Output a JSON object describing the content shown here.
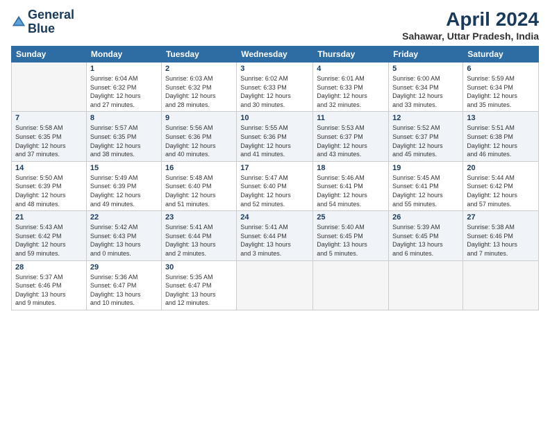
{
  "logo": {
    "line1": "General",
    "line2": "Blue"
  },
  "title": "April 2024",
  "subtitle": "Sahawar, Uttar Pradesh, India",
  "weekdays": [
    "Sunday",
    "Monday",
    "Tuesday",
    "Wednesday",
    "Thursday",
    "Friday",
    "Saturday"
  ],
  "weeks": [
    [
      {
        "day": "",
        "info": ""
      },
      {
        "day": "1",
        "info": "Sunrise: 6:04 AM\nSunset: 6:32 PM\nDaylight: 12 hours\nand 27 minutes."
      },
      {
        "day": "2",
        "info": "Sunrise: 6:03 AM\nSunset: 6:32 PM\nDaylight: 12 hours\nand 28 minutes."
      },
      {
        "day": "3",
        "info": "Sunrise: 6:02 AM\nSunset: 6:33 PM\nDaylight: 12 hours\nand 30 minutes."
      },
      {
        "day": "4",
        "info": "Sunrise: 6:01 AM\nSunset: 6:33 PM\nDaylight: 12 hours\nand 32 minutes."
      },
      {
        "day": "5",
        "info": "Sunrise: 6:00 AM\nSunset: 6:34 PM\nDaylight: 12 hours\nand 33 minutes."
      },
      {
        "day": "6",
        "info": "Sunrise: 5:59 AM\nSunset: 6:34 PM\nDaylight: 12 hours\nand 35 minutes."
      }
    ],
    [
      {
        "day": "7",
        "info": "Sunrise: 5:58 AM\nSunset: 6:35 PM\nDaylight: 12 hours\nand 37 minutes."
      },
      {
        "day": "8",
        "info": "Sunrise: 5:57 AM\nSunset: 6:35 PM\nDaylight: 12 hours\nand 38 minutes."
      },
      {
        "day": "9",
        "info": "Sunrise: 5:56 AM\nSunset: 6:36 PM\nDaylight: 12 hours\nand 40 minutes."
      },
      {
        "day": "10",
        "info": "Sunrise: 5:55 AM\nSunset: 6:36 PM\nDaylight: 12 hours\nand 41 minutes."
      },
      {
        "day": "11",
        "info": "Sunrise: 5:53 AM\nSunset: 6:37 PM\nDaylight: 12 hours\nand 43 minutes."
      },
      {
        "day": "12",
        "info": "Sunrise: 5:52 AM\nSunset: 6:37 PM\nDaylight: 12 hours\nand 45 minutes."
      },
      {
        "day": "13",
        "info": "Sunrise: 5:51 AM\nSunset: 6:38 PM\nDaylight: 12 hours\nand 46 minutes."
      }
    ],
    [
      {
        "day": "14",
        "info": "Sunrise: 5:50 AM\nSunset: 6:39 PM\nDaylight: 12 hours\nand 48 minutes."
      },
      {
        "day": "15",
        "info": "Sunrise: 5:49 AM\nSunset: 6:39 PM\nDaylight: 12 hours\nand 49 minutes."
      },
      {
        "day": "16",
        "info": "Sunrise: 5:48 AM\nSunset: 6:40 PM\nDaylight: 12 hours\nand 51 minutes."
      },
      {
        "day": "17",
        "info": "Sunrise: 5:47 AM\nSunset: 6:40 PM\nDaylight: 12 hours\nand 52 minutes."
      },
      {
        "day": "18",
        "info": "Sunrise: 5:46 AM\nSunset: 6:41 PM\nDaylight: 12 hours\nand 54 minutes."
      },
      {
        "day": "19",
        "info": "Sunrise: 5:45 AM\nSunset: 6:41 PM\nDaylight: 12 hours\nand 55 minutes."
      },
      {
        "day": "20",
        "info": "Sunrise: 5:44 AM\nSunset: 6:42 PM\nDaylight: 12 hours\nand 57 minutes."
      }
    ],
    [
      {
        "day": "21",
        "info": "Sunrise: 5:43 AM\nSunset: 6:42 PM\nDaylight: 12 hours\nand 59 minutes."
      },
      {
        "day": "22",
        "info": "Sunrise: 5:42 AM\nSunset: 6:43 PM\nDaylight: 13 hours\nand 0 minutes."
      },
      {
        "day": "23",
        "info": "Sunrise: 5:41 AM\nSunset: 6:44 PM\nDaylight: 13 hours\nand 2 minutes."
      },
      {
        "day": "24",
        "info": "Sunrise: 5:41 AM\nSunset: 6:44 PM\nDaylight: 13 hours\nand 3 minutes."
      },
      {
        "day": "25",
        "info": "Sunrise: 5:40 AM\nSunset: 6:45 PM\nDaylight: 13 hours\nand 5 minutes."
      },
      {
        "day": "26",
        "info": "Sunrise: 5:39 AM\nSunset: 6:45 PM\nDaylight: 13 hours\nand 6 minutes."
      },
      {
        "day": "27",
        "info": "Sunrise: 5:38 AM\nSunset: 6:46 PM\nDaylight: 13 hours\nand 7 minutes."
      }
    ],
    [
      {
        "day": "28",
        "info": "Sunrise: 5:37 AM\nSunset: 6:46 PM\nDaylight: 13 hours\nand 9 minutes."
      },
      {
        "day": "29",
        "info": "Sunrise: 5:36 AM\nSunset: 6:47 PM\nDaylight: 13 hours\nand 10 minutes."
      },
      {
        "day": "30",
        "info": "Sunrise: 5:35 AM\nSunset: 6:47 PM\nDaylight: 13 hours\nand 12 minutes."
      },
      {
        "day": "",
        "info": ""
      },
      {
        "day": "",
        "info": ""
      },
      {
        "day": "",
        "info": ""
      },
      {
        "day": "",
        "info": ""
      }
    ]
  ]
}
